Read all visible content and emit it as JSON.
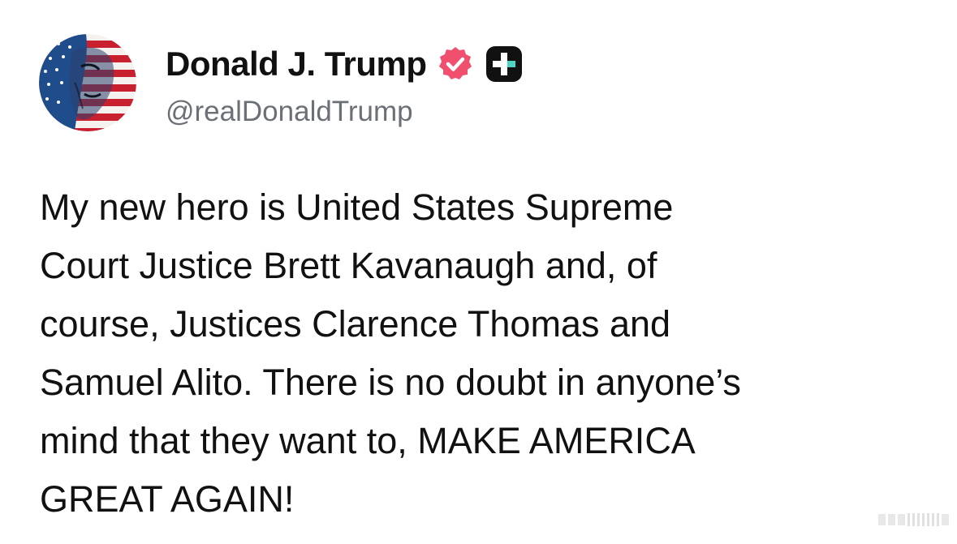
{
  "post": {
    "author": {
      "display_name": "Donald J. Trump",
      "handle": "@realDonaldTrump",
      "avatar_icon": "flag-portrait-avatar",
      "verified_icon": "verified-badge-icon",
      "verified_color": "#f0506e",
      "platform_icon": "truth-social-logo-icon"
    },
    "text_lines": [
      "My new hero is United States Supreme",
      "Court Justice Brett Kavanaugh and, of",
      "course, Justices Clarence Thomas and",
      "Samuel Alito. There is no doubt in anyone’s",
      "mind that they want to, MAKE AMERICA",
      "GREAT AGAIN!"
    ]
  },
  "colors": {
    "text": "#111111",
    "handle": "#6b6f76",
    "background": "#ffffff"
  }
}
